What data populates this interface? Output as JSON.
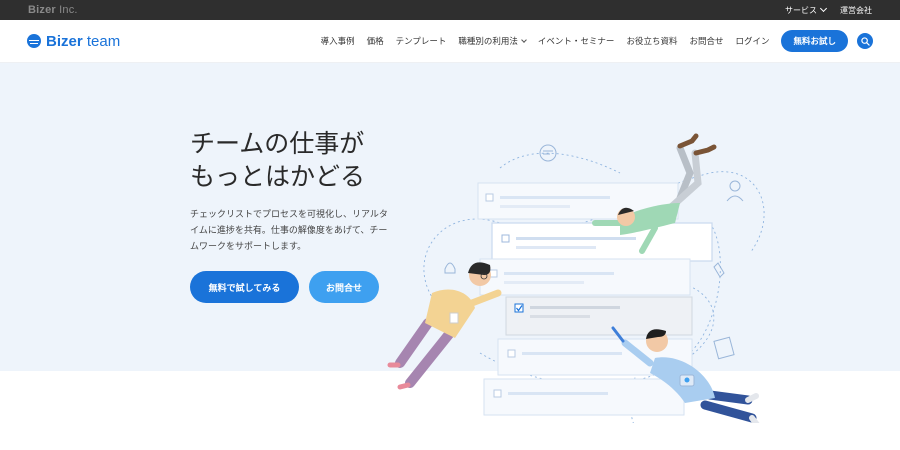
{
  "topbar": {
    "corp_bold": "Bizer",
    "corp_rest": " Inc.",
    "links": [
      "サービス",
      "運営会社"
    ]
  },
  "header": {
    "logo_bold": "Bizer",
    "logo_rest": " team",
    "nav": [
      "導入事例",
      "価格",
      "テンプレート",
      "職種別の利用法",
      "イベント・セミナー",
      "お役立ち資料",
      "お問合せ",
      "ログイン"
    ],
    "cta": "無料お試し",
    "search_icon": "search-icon"
  },
  "hero": {
    "headline_line1": "チームの仕事が",
    "headline_line2": "もっとはかどる",
    "lead_line1": "チェックリストでプロセスを可視化し、リアルタ",
    "lead_line2": "イムに進捗を共有。仕事の解像度をあげて、チー",
    "lead_line3": "ムワークをサポートします。",
    "primary_button": "無料で試してみる",
    "secondary_button": "お問合せ"
  },
  "colors": {
    "brand": "#1a73d9",
    "brand_light": "#3ea0f0",
    "hero_bg": "#eef4fb",
    "topbar_bg": "#2f2f2f"
  }
}
